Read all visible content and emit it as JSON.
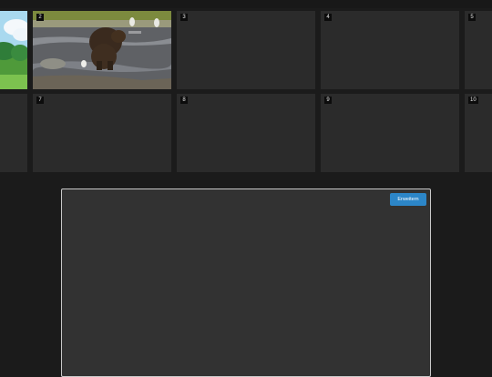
{
  "tiles": [
    {
      "number": "",
      "thumb": "cartoon-landscape"
    },
    {
      "number": "2",
      "thumb": "bear-river"
    },
    {
      "number": "3",
      "thumb": "empty"
    },
    {
      "number": "4",
      "thumb": "empty"
    },
    {
      "number": "5",
      "thumb": "empty"
    },
    {
      "number": "",
      "thumb": "empty"
    },
    {
      "number": "7",
      "thumb": "empty"
    },
    {
      "number": "8",
      "thumb": "empty"
    },
    {
      "number": "9",
      "thumb": "empty"
    },
    {
      "number": "10",
      "thumb": "empty"
    }
  ],
  "editor": {
    "expand_label": "Erweitern"
  },
  "colors": {
    "background": "#1b1b1b",
    "tile": "#2b2b2b",
    "accent": "#2c86c8"
  }
}
